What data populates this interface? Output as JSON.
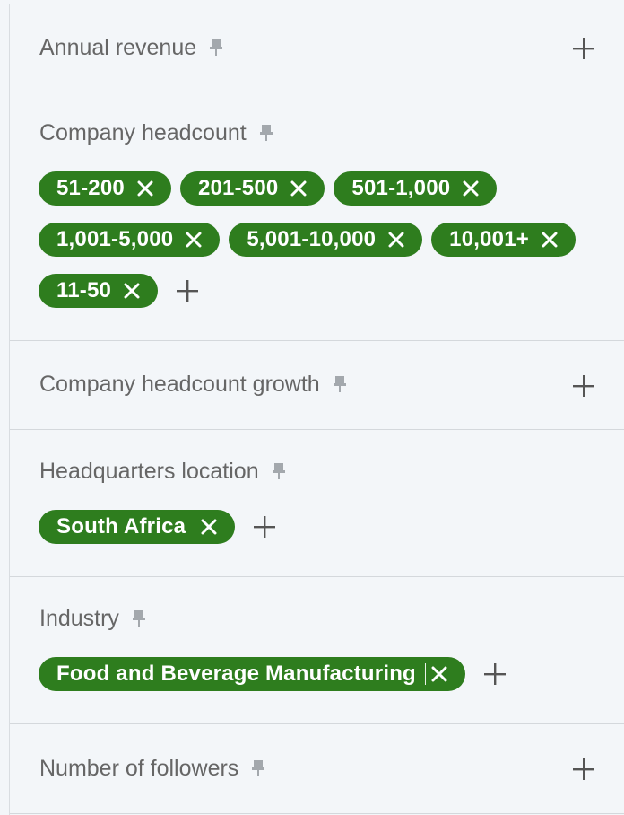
{
  "filters": [
    {
      "label": "Annual revenue",
      "chips": []
    },
    {
      "label": "Company headcount",
      "chips": [
        "51-200",
        "201-500",
        "501-1,000",
        "1,001-5,000",
        "5,001-10,000",
        "10,001+",
        "11-50"
      ]
    },
    {
      "label": "Company headcount growth",
      "chips": []
    },
    {
      "label": "Headquarters location",
      "chips": [
        "South Africa"
      ]
    },
    {
      "label": "Industry",
      "chips": [
        "Food and Beverage Manufacturing"
      ]
    },
    {
      "label": "Number of followers",
      "chips": []
    }
  ],
  "colors": {
    "chip_bg": "#2e7d1e",
    "label_text": "#666666",
    "panel_bg": "#f3f6f9"
  }
}
